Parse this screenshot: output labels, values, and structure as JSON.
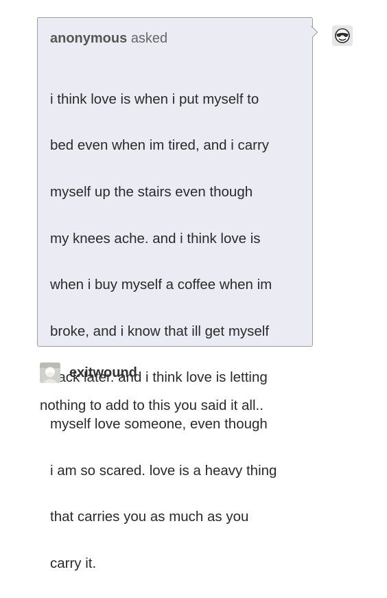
{
  "ask": {
    "asker_name": "anonymous",
    "asker_verb": "asked",
    "lines": [
      "i think love is when i put myself to",
      "bed even when im tired, and i carry",
      "myself up the stairs even though",
      "my knees ache. and i think love is",
      "when i buy myself a coffee when im",
      "broke, and i know that ill get myself",
      "back later. and i think love is letting",
      "myself love someone, even though",
      "i am so scared. love is a heavy thing",
      "that carries you as much as you",
      "carry it."
    ]
  },
  "answerer": {
    "avatar_icon": "sunglasses-face-avatar-icon"
  },
  "reply": {
    "username": "exitwound",
    "avatar_icon": "user-avatar-icon",
    "text": "nothing to add to this you said it all.."
  }
}
